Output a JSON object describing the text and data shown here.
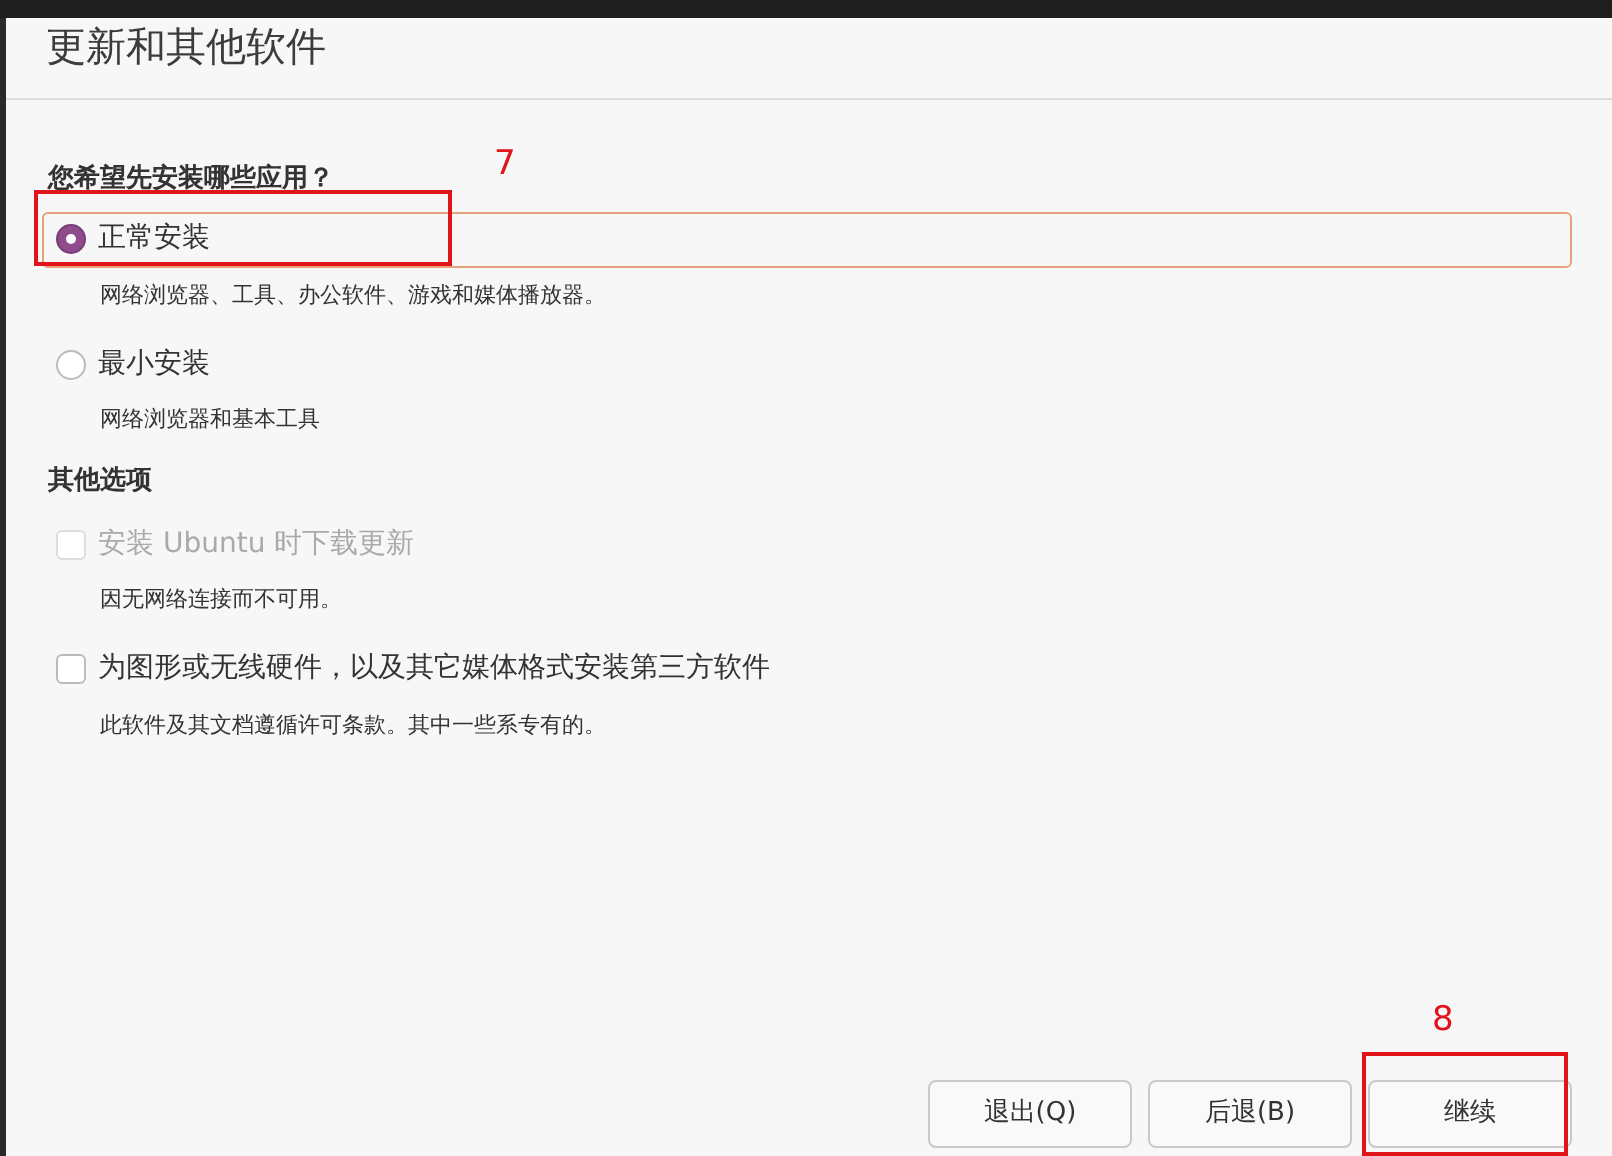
{
  "window": {
    "title": "更新和其他软件"
  },
  "install_type": {
    "heading": "您希望先安装哪些应用？",
    "options": [
      {
        "label": "正常安装",
        "description": "网络浏览器、工具、办公软件、游戏和媒体播放器。",
        "selected": true
      },
      {
        "label": "最小安装",
        "description": "网络浏览器和基本工具",
        "selected": false
      }
    ]
  },
  "other_options": {
    "heading": "其他选项",
    "options": [
      {
        "label": "安装 Ubuntu 时下载更新",
        "description": "因无网络连接而不可用。",
        "checked": false,
        "disabled": true
      },
      {
        "label": "为图形或无线硬件，以及其它媒体格式安装第三方软件",
        "description": "此软件及其文档遵循许可条款。其中一些系专有的。",
        "checked": false,
        "disabled": false
      }
    ]
  },
  "buttons": [
    {
      "label": "退出(Q)"
    },
    {
      "label": "后退(B)"
    },
    {
      "label": "继续"
    }
  ],
  "annotations": [
    {
      "label": "7"
    },
    {
      "label": "8"
    }
  ]
}
